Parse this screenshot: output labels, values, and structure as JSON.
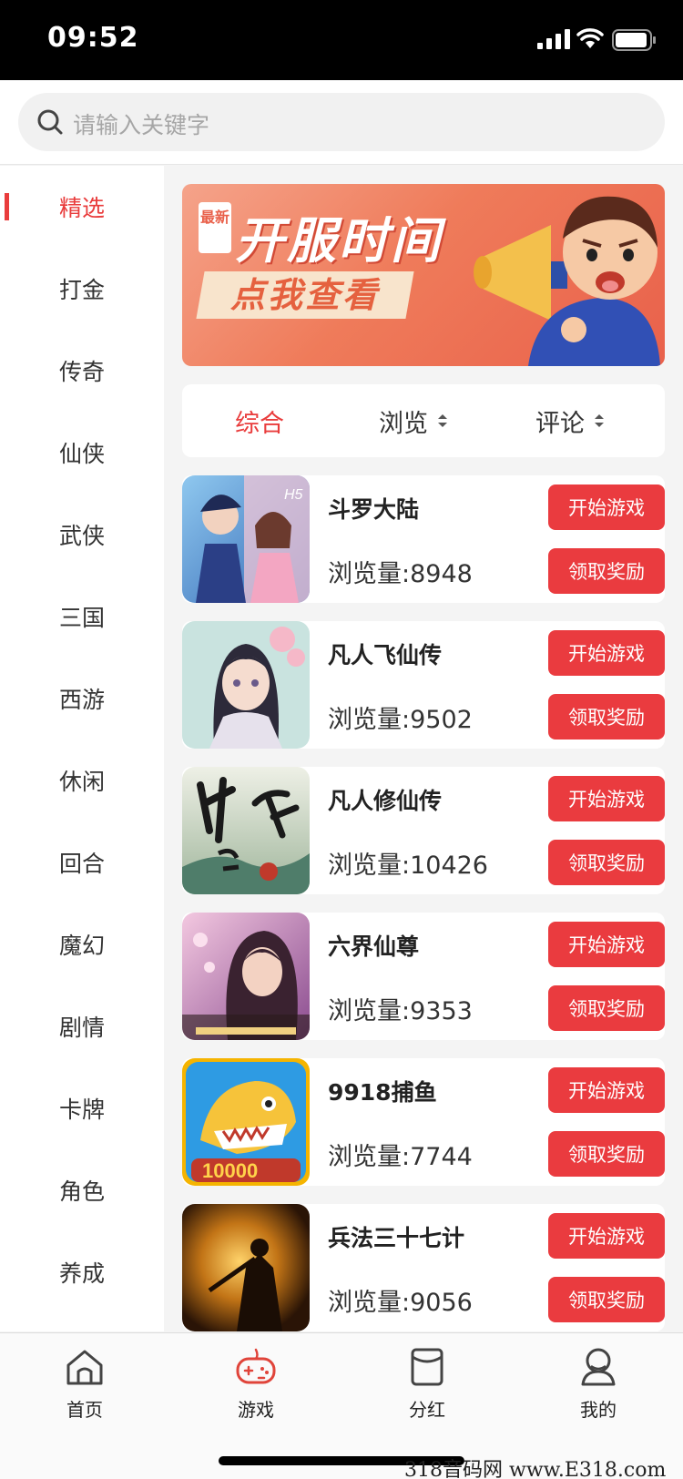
{
  "status_bar": {
    "time": "09:52"
  },
  "search": {
    "placeholder": "请输入关键字"
  },
  "sidebar": {
    "items": [
      {
        "label": "精选",
        "active": true
      },
      {
        "label": "打金"
      },
      {
        "label": "传奇"
      },
      {
        "label": "仙侠"
      },
      {
        "label": "武侠"
      },
      {
        "label": "三国"
      },
      {
        "label": "西游"
      },
      {
        "label": "休闲"
      },
      {
        "label": "回合"
      },
      {
        "label": "魔幻"
      },
      {
        "label": "剧情"
      },
      {
        "label": "卡牌"
      },
      {
        "label": "角色"
      },
      {
        "label": "养成"
      }
    ]
  },
  "banner": {
    "tag": "最新",
    "headline": "开服时间",
    "cta": "点我查看"
  },
  "sort": {
    "items": [
      {
        "label": "综合",
        "active": true
      },
      {
        "label": "浏览",
        "sortable": true
      },
      {
        "label": "评论",
        "sortable": true
      }
    ]
  },
  "games": [
    {
      "name": "斗罗大陆",
      "views": "浏览量:8948",
      "play": "开始游戏",
      "reward": "领取奖励"
    },
    {
      "name": "凡人飞仙传",
      "views": "浏览量:9502",
      "play": "开始游戏",
      "reward": "领取奖励"
    },
    {
      "name": "凡人修仙传",
      "views": "浏览量:10426",
      "play": "开始游戏",
      "reward": "领取奖励"
    },
    {
      "name": "六界仙尊",
      "views": "浏览量:9353",
      "play": "开始游戏",
      "reward": "领取奖励"
    },
    {
      "name": "9918捕鱼",
      "views": "浏览量:7744",
      "play": "开始游戏",
      "reward": "领取奖励"
    },
    {
      "name": "兵法三十七计",
      "views": "浏览量:9056",
      "play": "开始游戏",
      "reward": "领取奖励"
    }
  ],
  "tabs": [
    {
      "label": "首页",
      "icon": "home-icon"
    },
    {
      "label": "游戏",
      "icon": "gamepad-icon",
      "active": true
    },
    {
      "label": "分红",
      "icon": "wallet-icon"
    },
    {
      "label": "我的",
      "icon": "user-icon"
    }
  ],
  "watermark": "318音码网 www.E318.com",
  "colors": {
    "accent": "#e93c3c",
    "button": "#ea3b3f",
    "banner": "#ef7b5a"
  }
}
